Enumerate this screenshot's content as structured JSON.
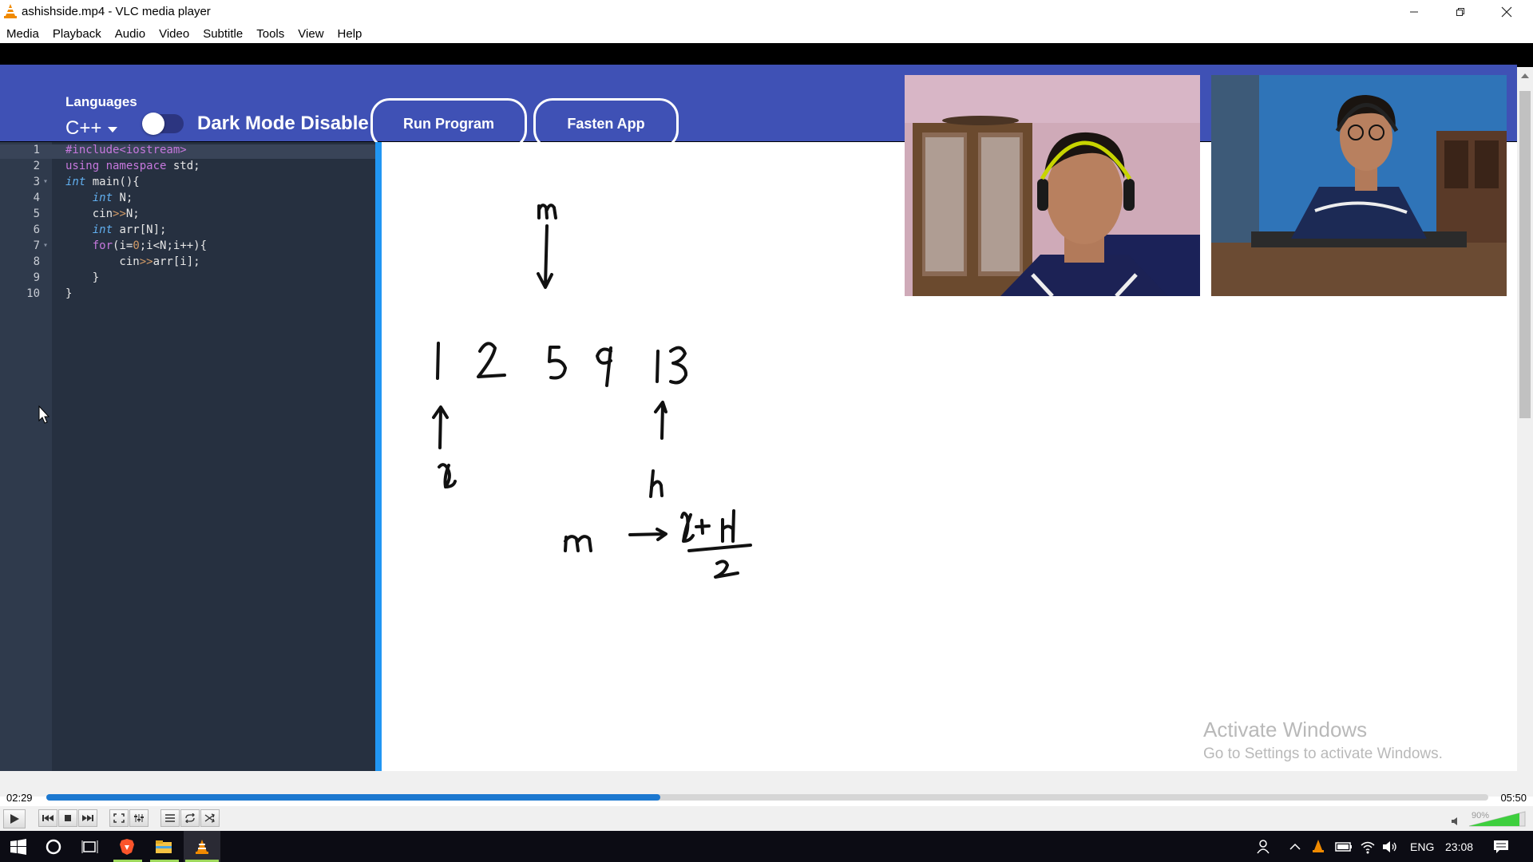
{
  "window": {
    "title": "ashishside.mp4 - VLC media player",
    "icon": "vlc-cone-icon",
    "controls": [
      "minimize-icon",
      "restore-icon",
      "close-icon"
    ]
  },
  "menu": [
    "Media",
    "Playback",
    "Audio",
    "Video",
    "Subtitle",
    "Tools",
    "View",
    "Help"
  ],
  "app": {
    "languages_label": "Languages",
    "language_value": "C++",
    "dark_mode_label": "Dark Mode Disable",
    "dark_mode_on": false,
    "run_button": "Run Program",
    "fasten_button": "Fasten App",
    "header_color": "#3f51b5"
  },
  "editor": {
    "lines": [
      {
        "n": "1",
        "fold": false,
        "segments": [
          {
            "t": "#include<iostream>",
            "c": "pp"
          }
        ]
      },
      {
        "n": "2",
        "fold": false,
        "segments": [
          {
            "t": "using ",
            "c": "kw"
          },
          {
            "t": "namespace ",
            "c": "kw"
          },
          {
            "t": "std;",
            "c": "pl"
          }
        ]
      },
      {
        "n": "3",
        "fold": true,
        "segments": [
          {
            "t": "int ",
            "c": "ty"
          },
          {
            "t": "main(){",
            "c": "pl"
          }
        ]
      },
      {
        "n": "4",
        "fold": false,
        "segments": [
          {
            "t": "    ",
            "c": "pl"
          },
          {
            "t": "int ",
            "c": "ty"
          },
          {
            "t": "N;",
            "c": "pl"
          }
        ]
      },
      {
        "n": "5",
        "fold": false,
        "segments": [
          {
            "t": "    cin",
            "c": "pl"
          },
          {
            "t": ">>",
            "c": "op"
          },
          {
            "t": "N;",
            "c": "pl"
          }
        ]
      },
      {
        "n": "6",
        "fold": false,
        "segments": [
          {
            "t": "    ",
            "c": "pl"
          },
          {
            "t": "int ",
            "c": "ty"
          },
          {
            "t": "arr[N];",
            "c": "pl"
          }
        ]
      },
      {
        "n": "7",
        "fold": true,
        "segments": [
          {
            "t": "    ",
            "c": "pl"
          },
          {
            "t": "for",
            "c": "kw"
          },
          {
            "t": "(i=",
            "c": "pl"
          },
          {
            "t": "0",
            "c": "op"
          },
          {
            "t": ";i<N;i++){",
            "c": "pl"
          }
        ]
      },
      {
        "n": "8",
        "fold": false,
        "segments": [
          {
            "t": "        cin",
            "c": "pl"
          },
          {
            "t": ">>",
            "c": "op"
          },
          {
            "t": "arr[i];",
            "c": "pl"
          }
        ]
      },
      {
        "n": "9",
        "fold": false,
        "segments": [
          {
            "t": "    }",
            "c": "pl"
          }
        ]
      },
      {
        "n": "10",
        "fold": false,
        "segments": [
          {
            "t": "}",
            "c": "pl"
          }
        ]
      }
    ]
  },
  "watermark": {
    "line1": "Activate Windows",
    "line2": "Go to Settings to activate Windows."
  },
  "player": {
    "current_time": "02:29",
    "total_time": "05:50",
    "progress_fraction": 0.426,
    "volume_label": "90%",
    "volume_fraction": 0.9,
    "accent": "#1c78d0",
    "buttons": [
      "play-icon",
      "previous-icon",
      "stop-icon",
      "next-icon",
      "fullscreen-icon",
      "extended-settings-icon",
      "playlist-icon",
      "loop-icon",
      "shuffle-icon"
    ]
  },
  "taskbar": {
    "icons": [
      "windows-start-icon",
      "cortana-icon",
      "task-view-icon",
      "brave-browser-icon",
      "file-explorer-icon",
      "vlc-taskbar-icon"
    ],
    "tray_icons": [
      "people-icon",
      "chevron-up-icon",
      "vlc-tray-icon",
      "battery-icon",
      "wifi-icon",
      "speaker-icon"
    ],
    "language": "ENG",
    "clock": "23:08",
    "notification_icon": "notification-icon"
  }
}
